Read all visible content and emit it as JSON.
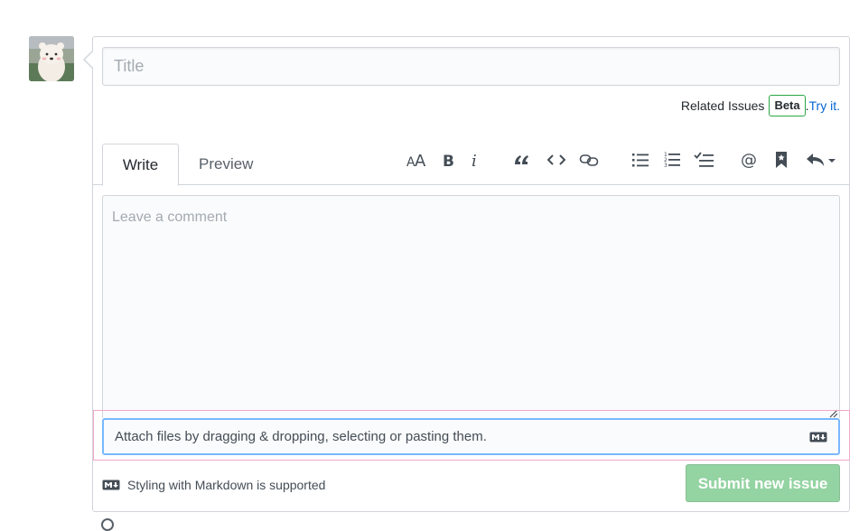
{
  "title_input": {
    "placeholder": "Title",
    "value": ""
  },
  "related": {
    "label": "Related Issues",
    "badge": "Beta",
    "sep": ".",
    "link": "Try it."
  },
  "tabs": [
    {
      "label": "Write"
    },
    {
      "label": "Preview"
    }
  ],
  "toolbar": {
    "icons": [
      "text-size-icon",
      "bold-icon",
      "italic-icon",
      "quote-icon",
      "code-icon",
      "link-icon",
      "unordered-list-icon",
      "ordered-list-icon",
      "task-list-icon",
      "mention-icon",
      "bookmark-icon",
      "reply-icon"
    ]
  },
  "comment": {
    "placeholder": "Leave a comment",
    "value": ""
  },
  "attach": {
    "text": "Attach files by dragging & dropping, selecting or pasting them."
  },
  "footer": {
    "note": "Styling with Markdown is supported"
  },
  "submit": {
    "label": "Submit new issue"
  },
  "colors": {
    "submit_disabled": "#94d3a2",
    "link": "#0366d6",
    "beta_border": "#28a745",
    "focus_border": "#79b8ff",
    "highlight": "#f2a7c6"
  }
}
